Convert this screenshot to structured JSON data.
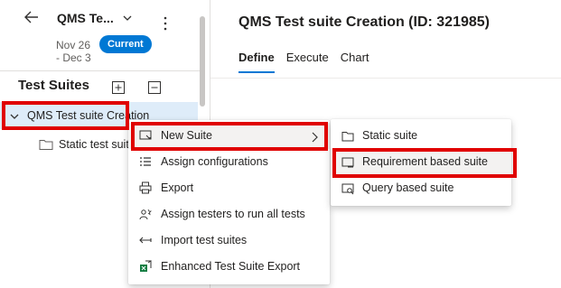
{
  "header": {
    "iteration_label": "QMS Te...",
    "dates_line1": "Nov 26",
    "dates_line2": "- Dec 3",
    "current_badge": "Current"
  },
  "sidebar": {
    "title": "Test Suites",
    "tree": {
      "root_label": "QMS Test suite Creation",
      "child_label": "Static test suite"
    }
  },
  "main": {
    "page_title": "QMS Test suite Creation (ID: 321985)",
    "tabs": [
      {
        "label": "Define"
      },
      {
        "label": "Execute"
      },
      {
        "label": "Chart"
      }
    ]
  },
  "context_menu": {
    "items": [
      {
        "label": "New Suite",
        "icon": "new-suite-icon"
      },
      {
        "label": "Assign configurations",
        "icon": "list-icon"
      },
      {
        "label": "Export",
        "icon": "print-icon"
      },
      {
        "label": "Assign testers to run all tests",
        "icon": "people-icon"
      },
      {
        "label": "Import test suites",
        "icon": "import-arrow-icon"
      },
      {
        "label": "Enhanced Test Suite Export",
        "icon": "excel-export-icon"
      }
    ]
  },
  "submenu": {
    "items": [
      {
        "label": "Static suite",
        "icon": "folder-icon"
      },
      {
        "label": "Requirement based suite",
        "icon": "requirement-suite-icon"
      },
      {
        "label": "Query based suite",
        "icon": "query-suite-icon"
      }
    ]
  },
  "colors": {
    "accent": "#0078d4",
    "selected_row": "#deecf9",
    "annotation_red": "#e00000"
  }
}
